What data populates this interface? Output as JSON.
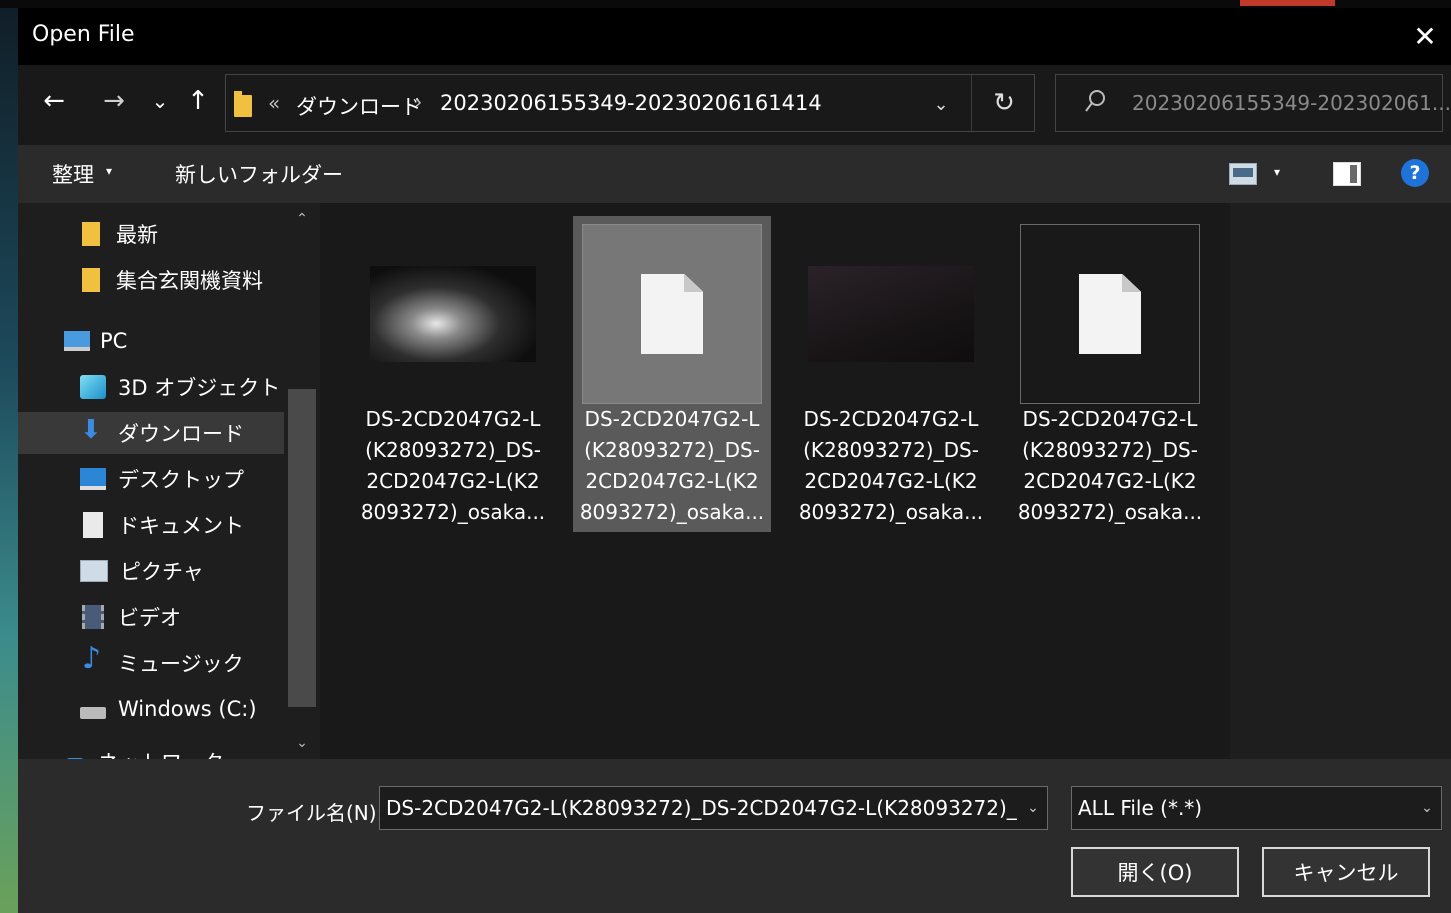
{
  "window": {
    "title": "Open File",
    "close_glyph": "✕"
  },
  "nav": {
    "back_glyph": "←",
    "forward_glyph": "→",
    "recent_glyph": "⌄",
    "up_glyph": "↑"
  },
  "address": {
    "overflow_glyph": "«",
    "crumbs": [
      "ダウンロード",
      "20230206155349-20230206161414"
    ],
    "separator": "›",
    "dropdown_glyph": "⌄",
    "refresh_glyph": "↻"
  },
  "search": {
    "placeholder": "20230206155349-202302061..."
  },
  "toolbar": {
    "organize_label": "整理",
    "caret": "▾",
    "new_folder_label": "新しいフォルダー",
    "help_label": "?"
  },
  "sidebar": {
    "items": [
      {
        "label": "最新",
        "icon": "folder-icon"
      },
      {
        "label": "集合玄関機資料",
        "icon": "folder-icon"
      },
      {
        "label": "PC",
        "icon": "pc-icon"
      },
      {
        "label": "3D オブジェクト",
        "icon": "3d-objects-icon"
      },
      {
        "label": "ダウンロード",
        "icon": "download-icon",
        "selected": true
      },
      {
        "label": "デスクトップ",
        "icon": "desktop-icon"
      },
      {
        "label": "ドキュメント",
        "icon": "document-icon"
      },
      {
        "label": "ピクチャ",
        "icon": "pictures-icon"
      },
      {
        "label": "ビデオ",
        "icon": "video-icon"
      },
      {
        "label": "ミュージック",
        "icon": "music-icon"
      },
      {
        "label": "Windows (C:)",
        "icon": "drive-icon"
      },
      {
        "label": "ネットワーク",
        "icon": "network-icon"
      }
    ],
    "scroll_up": "⌃",
    "scroll_down": "⌄"
  },
  "files": [
    {
      "lines": [
        "DS-2CD2047G2-L",
        "(K28093272)_DS-",
        "2CD2047G2-L(K2",
        "8093272)_osaka..."
      ],
      "thumb": "camera-snapshot-bright",
      "selected": false
    },
    {
      "lines": [
        "DS-2CD2047G2-L",
        "(K28093272)_DS-",
        "2CD2047G2-L(K2",
        "8093272)_osaka..."
      ],
      "thumb": "generic-file-icon",
      "selected": true
    },
    {
      "lines": [
        "DS-2CD2047G2-L",
        "(K28093272)_DS-",
        "2CD2047G2-L(K2",
        "8093272)_osaka..."
      ],
      "thumb": "camera-snapshot-dark",
      "selected": false
    },
    {
      "lines": [
        "DS-2CD2047G2-L",
        "(K28093272)_DS-",
        "2CD2047G2-L(K2",
        "8093272)_osaka..."
      ],
      "thumb": "generic-file-icon",
      "selected": false
    }
  ],
  "footer": {
    "filename_label": "ファイル名(N):",
    "filename_value": "DS-2CD2047G2-L(K28093272)_DS-2CD2047G2-L(K28093272)_",
    "filetype_value": "ALL File (*.*)",
    "dropdown_glyph": "⌄",
    "open_label": "開く(O)",
    "cancel_label": "キャンセル"
  }
}
